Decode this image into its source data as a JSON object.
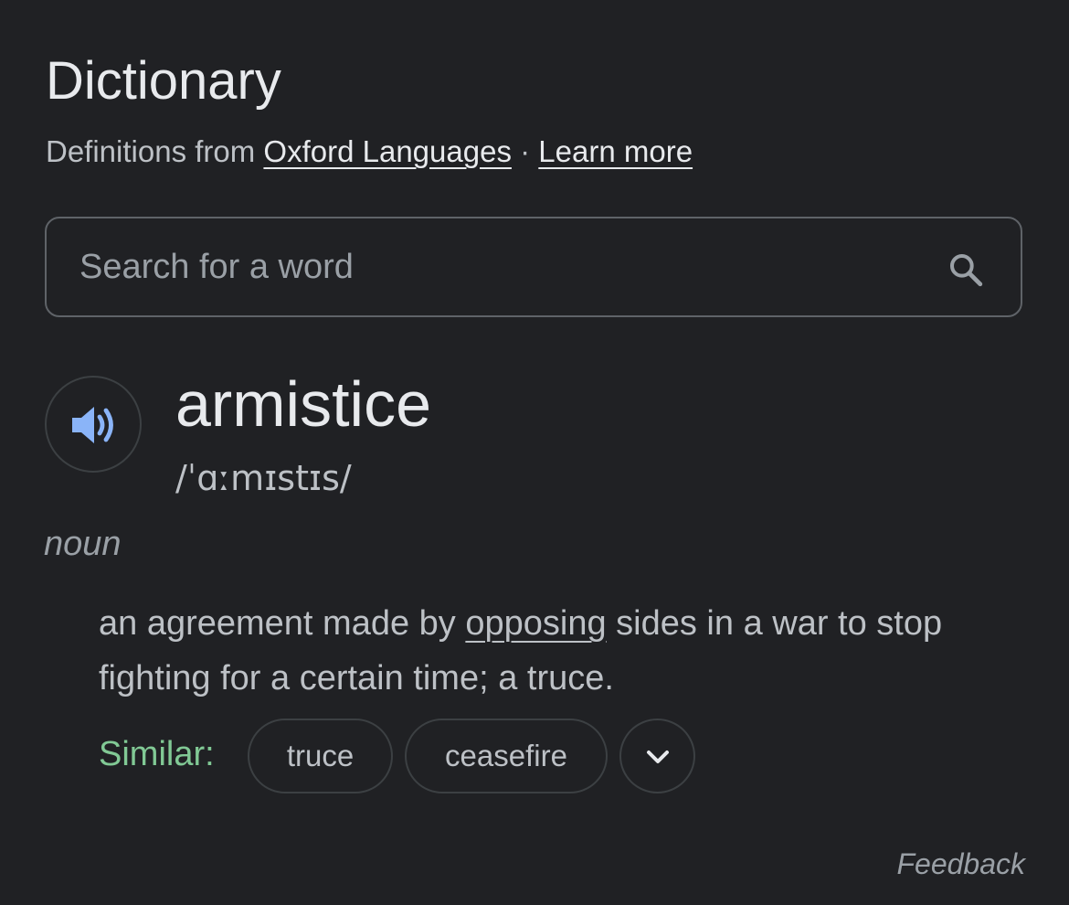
{
  "header": {
    "title": "Dictionary",
    "source_prefix": "Definitions from",
    "source_link": "Oxford Languages",
    "separator": "·",
    "learn_more": "Learn more"
  },
  "search": {
    "placeholder": "Search for a word",
    "value": "",
    "icon": "search-icon"
  },
  "entry": {
    "audio_icon": "speaker-icon",
    "word": "armistice",
    "phonetic": "/ˈɑːmɪstɪs/",
    "part_of_speech": "noun",
    "definition": {
      "before": "an agreement made by ",
      "link": "opposing",
      "after": " sides in a war to stop fighting for a certain time; a truce."
    },
    "similar_label": "Similar:",
    "similar": [
      "truce",
      "ceasefire"
    ],
    "expand_icon": "chevron-down-icon"
  },
  "footer": {
    "feedback": "Feedback"
  },
  "colors": {
    "background": "#202124",
    "text_primary": "#e8eaed",
    "text_secondary": "#bdc1c6",
    "similar_green": "#81c995",
    "speaker_blue": "#8ab4f8"
  }
}
